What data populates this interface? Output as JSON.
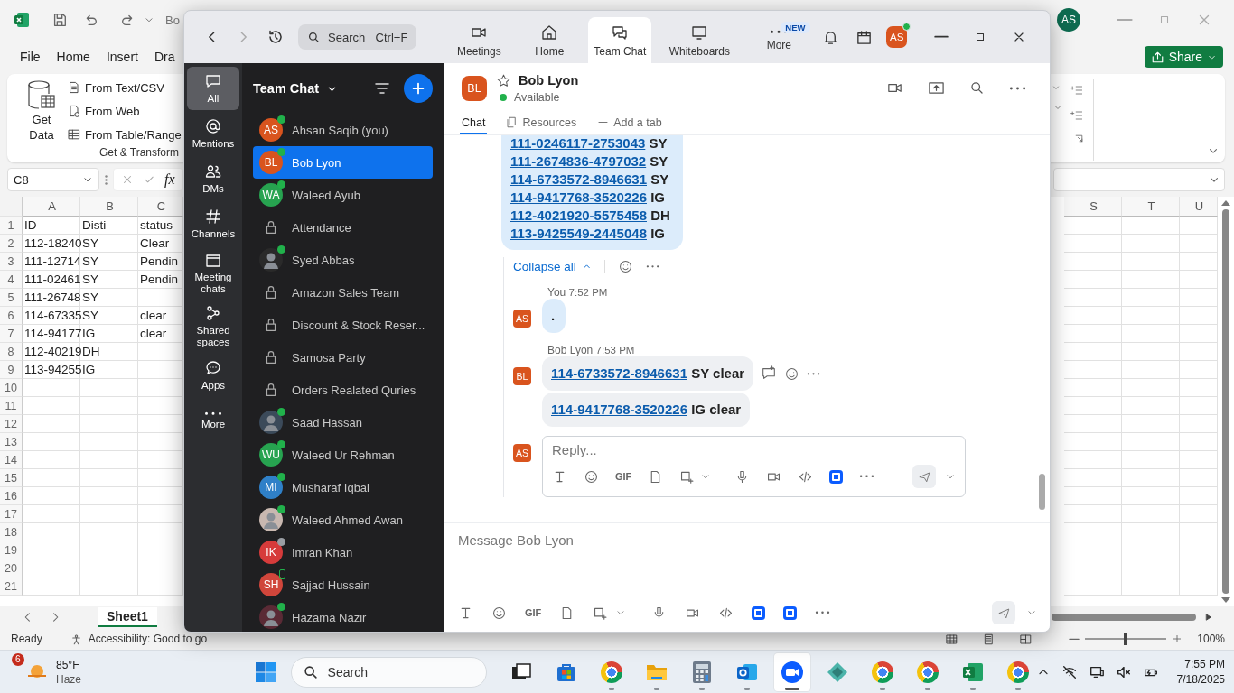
{
  "excel": {
    "title": "Bo",
    "account": "AS",
    "share": "Share",
    "menu": [
      {
        "label": "File"
      },
      {
        "label": "Home"
      },
      {
        "label": "Insert"
      },
      {
        "label": "Dra"
      }
    ],
    "ribbon": {
      "get_data": "Get Data",
      "commands": [
        {
          "kind": "text",
          "label": "From Text/CSV"
        },
        {
          "kind": "web",
          "label": "From Web"
        },
        {
          "kind": "table",
          "label": "From Table/Range"
        }
      ],
      "group": "Get & Transform"
    },
    "name_box": "C8",
    "formula_icon": "fx",
    "columns_left": [
      "A",
      "B",
      "C"
    ],
    "columns_right": [
      "S",
      "T",
      "U"
    ],
    "rows": [
      {
        "number": "1",
        "cells": [
          "ID",
          "Disti",
          "status"
        ]
      },
      {
        "number": "2",
        "cells": [
          "112-18240",
          "SY",
          "Clear"
        ]
      },
      {
        "number": "3",
        "cells": [
          "111-12714",
          "SY",
          "Pendin"
        ]
      },
      {
        "number": "4",
        "cells": [
          "111-02461",
          "SY",
          "Pendin"
        ]
      },
      {
        "number": "5",
        "cells": [
          "111-26748",
          "SY"
        ]
      },
      {
        "number": "6",
        "cells": [
          "114-67335",
          "SY",
          "clear"
        ]
      },
      {
        "number": "7",
        "cells": [
          "114-94177",
          "IG",
          "clear"
        ]
      },
      {
        "number": "8",
        "cells": [
          "112-40219",
          "DH"
        ]
      },
      {
        "number": "9",
        "cells": [
          "113-94255",
          "IG"
        ]
      },
      {
        "number": "10"
      },
      {
        "number": "11"
      },
      {
        "number": "12"
      },
      {
        "number": "13"
      },
      {
        "number": "14"
      },
      {
        "number": "15"
      },
      {
        "number": "16"
      },
      {
        "number": "17"
      },
      {
        "number": "18"
      },
      {
        "number": "19"
      },
      {
        "number": "20"
      },
      {
        "number": "21"
      }
    ],
    "sheets": [
      {
        "label": "Sheet1",
        "selected": true
      }
    ],
    "status": {
      "ready": "Ready",
      "accessibility": "Accessibility: Good to go",
      "zoom": "100%",
      "level": 0.5
    }
  },
  "zoom": {
    "search": {
      "placeholder": "Search",
      "shortcut": "Ctrl+F"
    },
    "tabs": [
      {
        "kind": "meetings",
        "label": "Meetings",
        "selected": false
      },
      {
        "kind": "home",
        "label": "Home",
        "selected": false
      },
      {
        "kind": "chat",
        "label": "Team Chat",
        "selected": true
      },
      {
        "kind": "whiteboards",
        "label": "Whiteboards",
        "selected": false
      },
      {
        "kind": "more",
        "label": "More",
        "selected": false,
        "badge": "NEW"
      }
    ],
    "account": {
      "initials": "AS",
      "color": "#d9541e"
    },
    "sidebar": {
      "items": [
        {
          "kind": "all",
          "label": "All",
          "selected": true
        },
        {
          "kind": "mentions",
          "label": "Mentions",
          "selected": false
        },
        {
          "kind": "dms",
          "label": "DMs",
          "selected": false
        },
        {
          "kind": "channels",
          "label": "Channels",
          "selected": false
        },
        {
          "kind": "meeting",
          "label": "Meeting chats",
          "selected": false
        },
        {
          "kind": "shared",
          "label": "Shared spaces",
          "selected": false
        },
        {
          "kind": "apps",
          "label": "Apps",
          "selected": false
        },
        {
          "kind": "more",
          "label": "More",
          "selected": false
        }
      ]
    },
    "chat_list": {
      "title": "Team Chat",
      "items": [
        {
          "kind": "avatar",
          "initials": "AS",
          "color": "#d9541e",
          "name": "Ahsan Saqib (you)",
          "status": {
            "color": "#21b14b",
            "mobile": false
          },
          "selected": false
        },
        {
          "kind": "avatar",
          "initials": "BL",
          "color": "#d9541e",
          "name": "Bob Lyon",
          "status": {
            "color": "#21b14b",
            "mobile": false
          },
          "selected": true
        },
        {
          "kind": "avatar",
          "initials": "WA",
          "color": "#27a350",
          "name": "Waleed Ayub",
          "status": {
            "color": "#21b14b",
            "mobile": false
          },
          "selected": false
        },
        {
          "kind": "channel",
          "name": "Attendance",
          "selected": false
        },
        {
          "kind": "photo",
          "color": "#2a2a2a",
          "name": "Syed Abbas",
          "status": {
            "color": "#21b14b",
            "mobile": false
          },
          "selected": false
        },
        {
          "kind": "channel",
          "name": "Amazon Sales Team",
          "selected": false
        },
        {
          "kind": "channel",
          "name": "Discount & Stock Reser...",
          "selected": false
        },
        {
          "kind": "channel",
          "name": "Samosa Party",
          "selected": false
        },
        {
          "kind": "channel",
          "name": "Orders Realated Quries",
          "selected": false
        },
        {
          "kind": "photo",
          "color": "#3b4a5a",
          "name": "Saad Hassan",
          "status": {
            "color": "#21b14b",
            "mobile": false
          },
          "selected": false
        },
        {
          "kind": "avatar",
          "initials": "WU",
          "color": "#27a350",
          "name": "Waleed Ur Rehman",
          "status": {
            "color": "#21b14b",
            "mobile": false
          },
          "selected": false
        },
        {
          "kind": "avatar",
          "initials": "MI",
          "color": "#2f80c8",
          "name": "Musharaf Iqbal",
          "status": {
            "color": "#21b14b",
            "mobile": false
          },
          "selected": false
        },
        {
          "kind": "photo",
          "color": "#c9b8b0",
          "name": "Waleed Ahmed Awan",
          "status": {
            "color": "#21b14b",
            "mobile": false
          },
          "selected": false
        },
        {
          "kind": "avatar",
          "initials": "IK",
          "color": "#d63b3b",
          "name": "Imran Khan",
          "status": {
            "color": "#9a9ea4",
            "mobile": false
          },
          "selected": false
        },
        {
          "kind": "avatar",
          "initials": "SH",
          "color": "#d0463b",
          "name": "Sajjad Hussain",
          "status": {
            "color": "#21b14b",
            "mobile": true
          },
          "selected": false
        },
        {
          "kind": "photo",
          "color": "#5a2a35",
          "name": "Hazama Nazir",
          "status": {
            "color": "#21b14b",
            "mobile": false
          },
          "selected": false
        }
      ]
    },
    "conversation": {
      "contact": {
        "initials": "BL",
        "color": "#d9541e",
        "name": "Bob Lyon",
        "status": "Available",
        "favorite": false
      },
      "tabs": [
        {
          "kind": "chat",
          "label": "Chat",
          "selected": true
        },
        {
          "kind": "resources",
          "label": "Resources",
          "selected": false
        },
        {
          "kind": "add",
          "label": "Add a tab",
          "selected": false
        }
      ],
      "parent_lines": [
        {
          "link": "111-0246117-2753043",
          "code": "SY"
        },
        {
          "link": "111-2674836-4797032",
          "code": "SY"
        },
        {
          "link": "114-6733572-8946631",
          "code": "SY"
        },
        {
          "link": "114-9417768-3520226",
          "code": "IG"
        },
        {
          "link": "112-4021920-5575458",
          "code": "DH"
        },
        {
          "link": "113-9425549-2445048",
          "code": "IG"
        }
      ],
      "collapse": "Collapse all",
      "replies": [
        {
          "author": "You",
          "time": "7:52 PM",
          "initials": "AS",
          "color": "#d9541e",
          "bubbles": [
            {
              "text": "."
            }
          ]
        },
        {
          "author": "Bob Lyon",
          "time": "7:53 PM",
          "initials": "BL",
          "color": "#d9541e",
          "bubbles": [
            {
              "link": "114-6733572-8946631",
              "text": "SY clear"
            },
            {
              "link": "114-9417768-3520226",
              "text": "IG clear"
            }
          ]
        }
      ],
      "reply_avatar": {
        "initials": "AS",
        "color": "#d9541e"
      },
      "reply_placeholder": "Reply...",
      "reply_tools": [
        {
          "kind": "format"
        },
        {
          "kind": "emoji"
        },
        {
          "kind": "gif",
          "label": "GIF"
        },
        {
          "kind": "file"
        },
        {
          "kind": "screenshot"
        },
        {
          "kind": "caret"
        },
        {
          "kind": "audio"
        },
        {
          "kind": "video"
        },
        {
          "kind": "code"
        },
        {
          "kind": "app"
        },
        {
          "kind": "more"
        }
      ],
      "composer_placeholder": "Message Bob Lyon",
      "composer_tools": [
        {
          "kind": "format"
        },
        {
          "kind": "emoji"
        },
        {
          "kind": "gif",
          "label": "GIF"
        },
        {
          "kind": "file"
        },
        {
          "kind": "screenshot"
        },
        {
          "kind": "caret"
        },
        {
          "kind": "audio"
        },
        {
          "kind": "video"
        },
        {
          "kind": "code"
        },
        {
          "kind": "app"
        },
        {
          "kind": "app"
        },
        {
          "kind": "more"
        }
      ]
    }
  },
  "taskbar": {
    "weather": {
      "badge": "6",
      "temp": "85°F",
      "condition": "Haze"
    },
    "search": {
      "placeholder": "Search"
    },
    "apps": [
      {
        "kind": "taskview",
        "active": false,
        "running": false
      },
      {
        "kind": "store",
        "active": false,
        "running": false
      },
      {
        "kind": "chrome",
        "active": false,
        "running": true
      },
      {
        "kind": "folder",
        "active": false,
        "running": true
      },
      {
        "kind": "calculator",
        "active": false,
        "running": true
      },
      {
        "kind": "mail",
        "active": false,
        "running": true
      },
      {
        "kind": "meeting",
        "active": true,
        "running": true
      },
      {
        "kind": "diamond",
        "active": false,
        "running": false
      },
      {
        "kind": "chrome",
        "active": false,
        "running": true
      },
      {
        "kind": "chrome",
        "active": false,
        "running": true
      },
      {
        "kind": "sheet",
        "active": false,
        "running": true
      },
      {
        "kind": "chrome",
        "active": false,
        "running": true
      }
    ],
    "clock": {
      "time": "7:55 PM",
      "date": "7/18/2025"
    }
  }
}
